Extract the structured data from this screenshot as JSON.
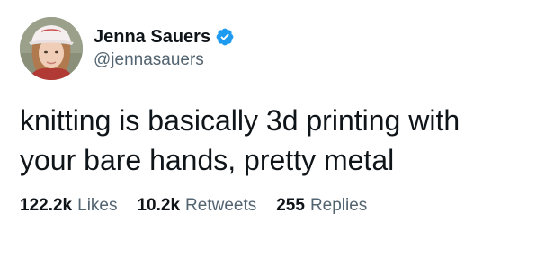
{
  "user": {
    "display_name": "Jenna Sauers",
    "handle": "@jennasauers",
    "verified": true,
    "avatar_icon": "profile-photo"
  },
  "tweet": {
    "text": "knitting is basically 3d printing with\nyour bare hands, pretty metal"
  },
  "stats": [
    {
      "count": "122.2k",
      "label": "Likes"
    },
    {
      "count": "10.2k",
      "label": "Retweets"
    },
    {
      "count": "255",
      "label": "Replies"
    }
  ],
  "colors": {
    "text": "#0f1419",
    "muted": "#536471",
    "verified_blue": "#1d9bf0"
  }
}
